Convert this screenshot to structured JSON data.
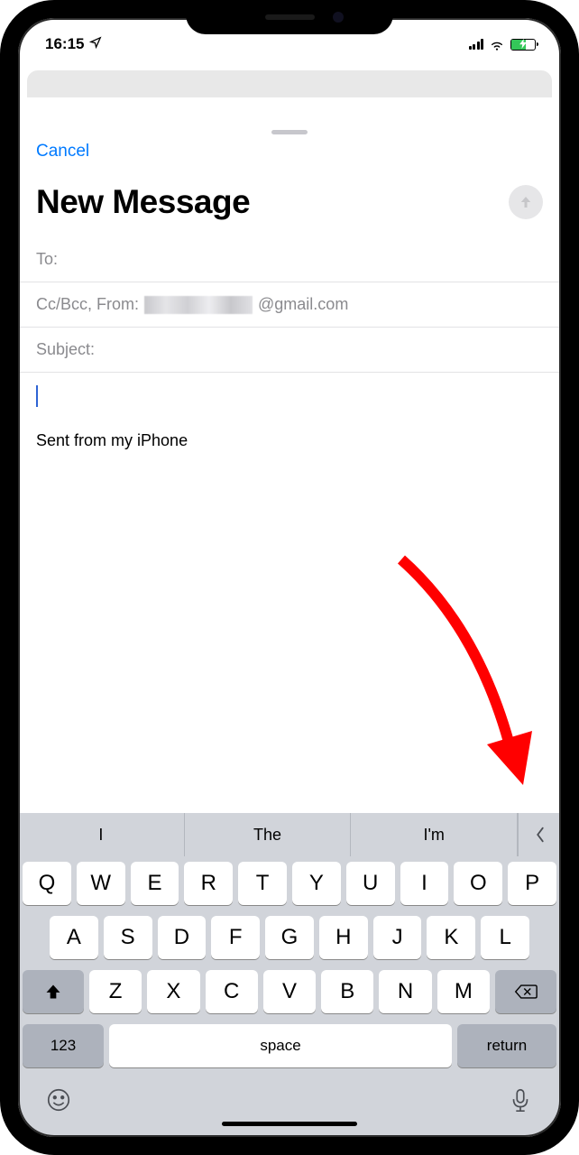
{
  "status": {
    "time": "16:15"
  },
  "sheet": {
    "cancel": "Cancel",
    "title": "New Message",
    "to_label": "To:",
    "ccbcc_from_label": "Cc/Bcc, From:",
    "from_domain": "@gmail.com",
    "subject_label": "Subject:",
    "signature": "Sent from my iPhone"
  },
  "keyboard": {
    "predictions": [
      "I",
      "The",
      "I'm"
    ],
    "row1": [
      "Q",
      "W",
      "E",
      "R",
      "T",
      "Y",
      "U",
      "I",
      "O",
      "P"
    ],
    "row2": [
      "A",
      "S",
      "D",
      "F",
      "G",
      "H",
      "J",
      "K",
      "L"
    ],
    "row3": [
      "Z",
      "X",
      "C",
      "V",
      "B",
      "N",
      "M"
    ],
    "num_label": "123",
    "space_label": "space",
    "return_label": "return"
  }
}
